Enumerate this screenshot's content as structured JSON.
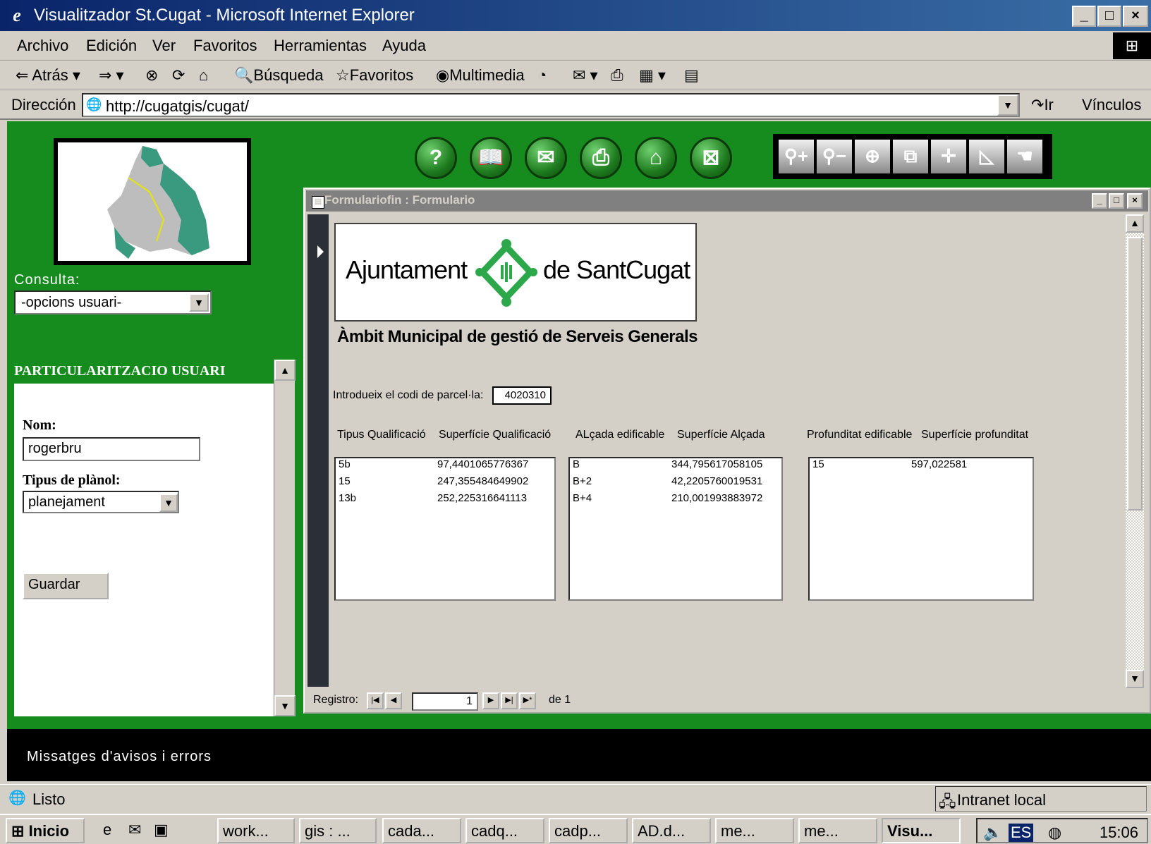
{
  "window": {
    "title": "Visualitzador St.Cugat - Microsoft Internet Explorer"
  },
  "menu": [
    "Archivo",
    "Edición",
    "Ver",
    "Favoritos",
    "Herramientas",
    "Ayuda"
  ],
  "toolbar": {
    "back": "Atrás",
    "search": "Búsqueda",
    "favorites": "Favoritos",
    "multimedia": "Multimedia"
  },
  "address": {
    "label": "Dirección",
    "url": "http://cugatgis/cugat/",
    "go": "Ir",
    "links": "Vínculos"
  },
  "left": {
    "consulta_label": "Consulta:",
    "consulta_value": "-opcions usuari-",
    "section_title": "PARTICULARITZACIO USUARI",
    "nom_label": "Nom:",
    "nom_value": "rogerbru",
    "tipus_label": "Tipus de plànol:",
    "tipus_value": "planejament",
    "save_label": "Guardar"
  },
  "icons": [
    "help-icon",
    "book-icon",
    "mail-icon",
    "print-icon",
    "home-icon",
    "close-icon"
  ],
  "tools": [
    "zoom-in-icon",
    "zoom-out-icon",
    "center-icon",
    "window-icon",
    "coordinates-icon",
    "measure-icon",
    "pan-icon"
  ],
  "form": {
    "title": "Formulariofin : Formulario",
    "logo_left": "Ajuntament",
    "logo_right": "de SantCugat",
    "subtitle": "Àmbit Municipal de gestió de Serveis Generals",
    "codi_label": "Introdueix el codi de parcel·la:",
    "codi_value": "4020310",
    "headers": {
      "tipus_q": "Tipus Qualificació",
      "sup_q": "Superfície Qualificació",
      "alcada": "ALçada edificable",
      "sup_a": "Superfície Alçada",
      "prof": "Profunditat edificable",
      "sup_p": "Superfície profunditat"
    },
    "qualificacio": [
      {
        "tipus": "5b",
        "sup": "97,4401065776367"
      },
      {
        "tipus": "15",
        "sup": "247,355484649902"
      },
      {
        "tipus": "13b",
        "sup": "252,225316641113"
      }
    ],
    "alcada": [
      {
        "tipus": "B",
        "sup": "344,795617058105"
      },
      {
        "tipus": "B+2",
        "sup": "42,2205760019531"
      },
      {
        "tipus": "B+4",
        "sup": "210,001993883972"
      }
    ],
    "profunditat": [
      {
        "tipus": "15",
        "sup": "597,022581"
      }
    ],
    "nav": {
      "label": "Registro:",
      "current": "1",
      "of": "de 1"
    }
  },
  "messages": "Missatges d'avisos i errors",
  "status": {
    "text": "Listo",
    "zone": "Intranet local"
  },
  "taskbar": {
    "start": "Inicio",
    "tasks": [
      "work...",
      "gis : ...",
      "cada...",
      "cadq...",
      "cadp...",
      "AD.d...",
      "me...",
      "me...",
      "Visu..."
    ],
    "lang": "ES",
    "clock": "15:06"
  },
  "colors": {
    "page_bg": "#178c1e",
    "title_bg": "#0a246a",
    "form_bg": "#d4d0c8"
  }
}
